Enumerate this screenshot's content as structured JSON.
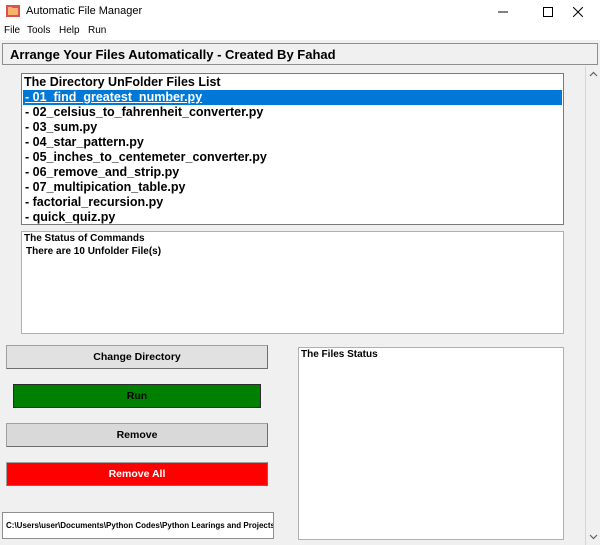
{
  "window": {
    "title": "Automatic File Manager",
    "icon": "folder-app-icon"
  },
  "menu": {
    "items": [
      "File",
      "Tools",
      "Help",
      "Run"
    ]
  },
  "header": {
    "text": "Arrange Your Files Automatically - Created By Fahad"
  },
  "files_list": {
    "heading": "The Directory UnFolder Files List",
    "items": [
      "-  01_find_greatest_number.py",
      "-  02_celsius_to_fahrenheit_converter.py",
      "-  03_sum.py",
      "-  04_star_pattern.py",
      "-  05_inches_to_centemeter_converter.py",
      "-  06_remove_and_strip.py",
      "-  07_multipication_table.py",
      "-  factorial_recursion.py",
      "-  quick_quiz.py"
    ],
    "selected_index": 0
  },
  "status": {
    "title": "The Status of Commands",
    "message": "There are 10 Unfolder File(s)"
  },
  "buttons": {
    "change_directory": "Change Directory",
    "run": "Run",
    "remove": "Remove",
    "remove_all": "Remove All"
  },
  "files_status": {
    "title": "The Files Status"
  },
  "path": {
    "value": "C:\\Users\\user\\Documents\\Python Codes\\Python Learings and Projects"
  },
  "colors": {
    "selection": "#0078d7",
    "run_button": "#008000",
    "remove_all_button": "#ff0000",
    "remove_button": "#d9d9d9",
    "app_icon": "#d9534f"
  }
}
